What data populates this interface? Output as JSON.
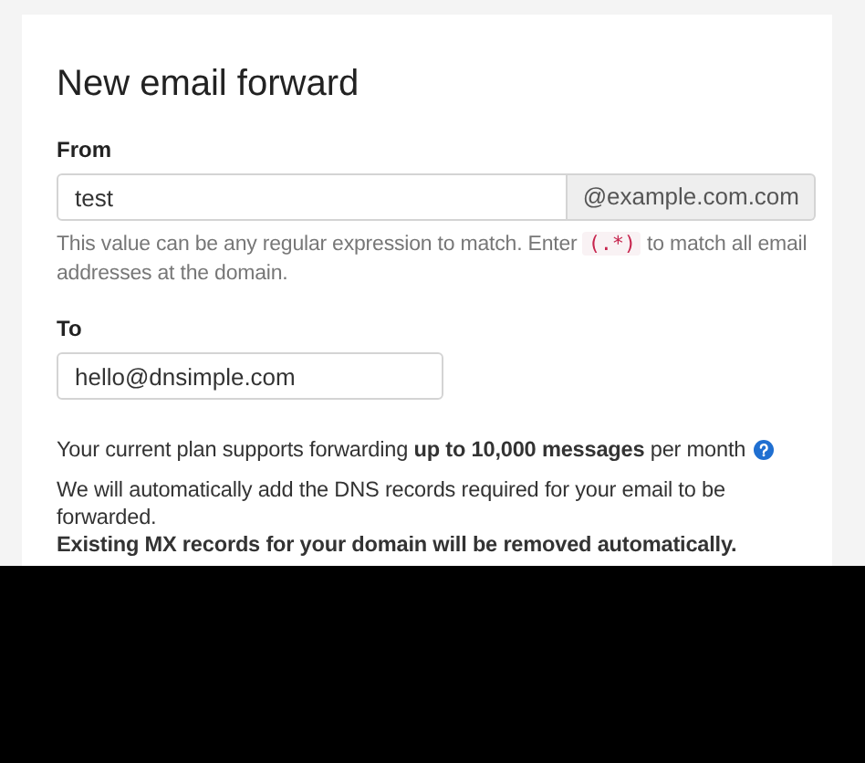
{
  "title": "New email forward",
  "from": {
    "label": "From",
    "value": "test",
    "addon": "@example.com.com",
    "help_before": "This value can be any regular expression to match. Enter ",
    "help_code": "(.*)",
    "help_after": " to match all email addresses at the domain."
  },
  "to": {
    "label": "To",
    "value": "hello@dnsimple.com"
  },
  "plan_note": "Your current plan supports forwarding **up to 10,000 messages** per month",
  "dns_note": "We will automatically add the DNS records required for your email to be forwarded.",
  "mx_warning": "Existing MX records for your domain will be removed automatically."
}
